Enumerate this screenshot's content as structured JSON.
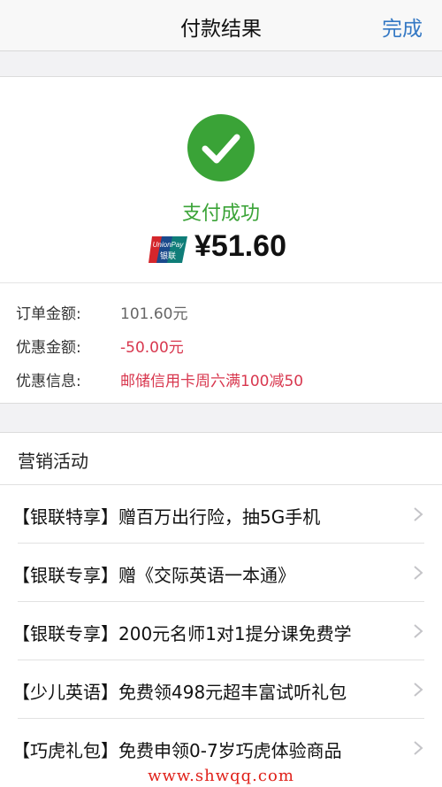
{
  "navbar": {
    "title": "付款结果",
    "done_label": "完成"
  },
  "result": {
    "status": "支付成功",
    "amount": "¥51.60",
    "success_color": "#3aa337",
    "payment_icon": "unionpay-logo-icon"
  },
  "details": [
    {
      "label": "订单金额:",
      "value": "101.60元",
      "style": "normal"
    },
    {
      "label": "优惠金额:",
      "value": "-50.00元",
      "style": "red"
    },
    {
      "label": "优惠信息:",
      "value": "邮储信用卡周六满100减50",
      "style": "red"
    }
  ],
  "marketing": {
    "title": "营销活动",
    "items": [
      {
        "label": "【银联特享】赠百万出行险，抽5G手机"
      },
      {
        "label": "【银联专享】赠《交际英语一本通》"
      },
      {
        "label": "【银联专享】200元名师1对1提分课免费学"
      },
      {
        "label": "【少儿英语】免费领498元超丰富试听礼包"
      },
      {
        "label": "【巧虎礼包】免费申领0-7岁巧虎体验商品"
      }
    ]
  },
  "watermark": "www.shwqq.com",
  "colors": {
    "accent_blue": "#3478c4",
    "discount_red": "#d8374e"
  }
}
